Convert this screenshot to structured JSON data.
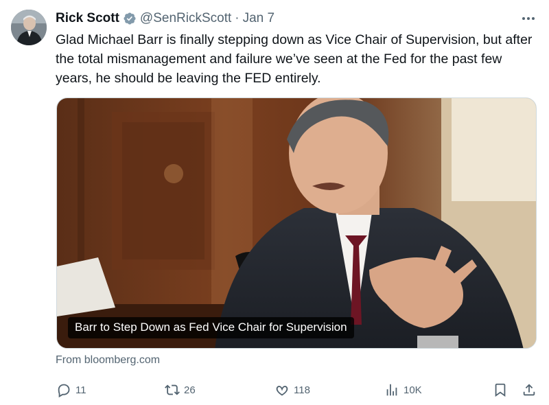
{
  "author": {
    "name": "Rick Scott",
    "handle": "@SenRickScott",
    "separator": "·",
    "date": "Jan 7"
  },
  "tweet": {
    "text": "Glad Michael Barr is finally stepping down as Vice Chair of Supervision, but after the total mismanagement and failure we’ve seen at the Fed for the past few years, he should be leaving the FED entirely."
  },
  "media": {
    "headline": "Barr to Step Down as Fed Vice Chair for Supervision",
    "source": "From bloomberg.com"
  },
  "actions": {
    "replies": "11",
    "reposts": "26",
    "likes": "118",
    "views": "10K"
  },
  "icons": {
    "verified": "verified-badge-icon",
    "more": "more-options-icon",
    "reply": "reply-icon",
    "repost": "repost-icon",
    "like": "heart-icon",
    "views": "views-icon",
    "bookmark": "bookmark-icon",
    "share": "share-icon"
  },
  "colors": {
    "text": "#0f1419",
    "secondary": "#536471",
    "verified": "#829aab"
  }
}
